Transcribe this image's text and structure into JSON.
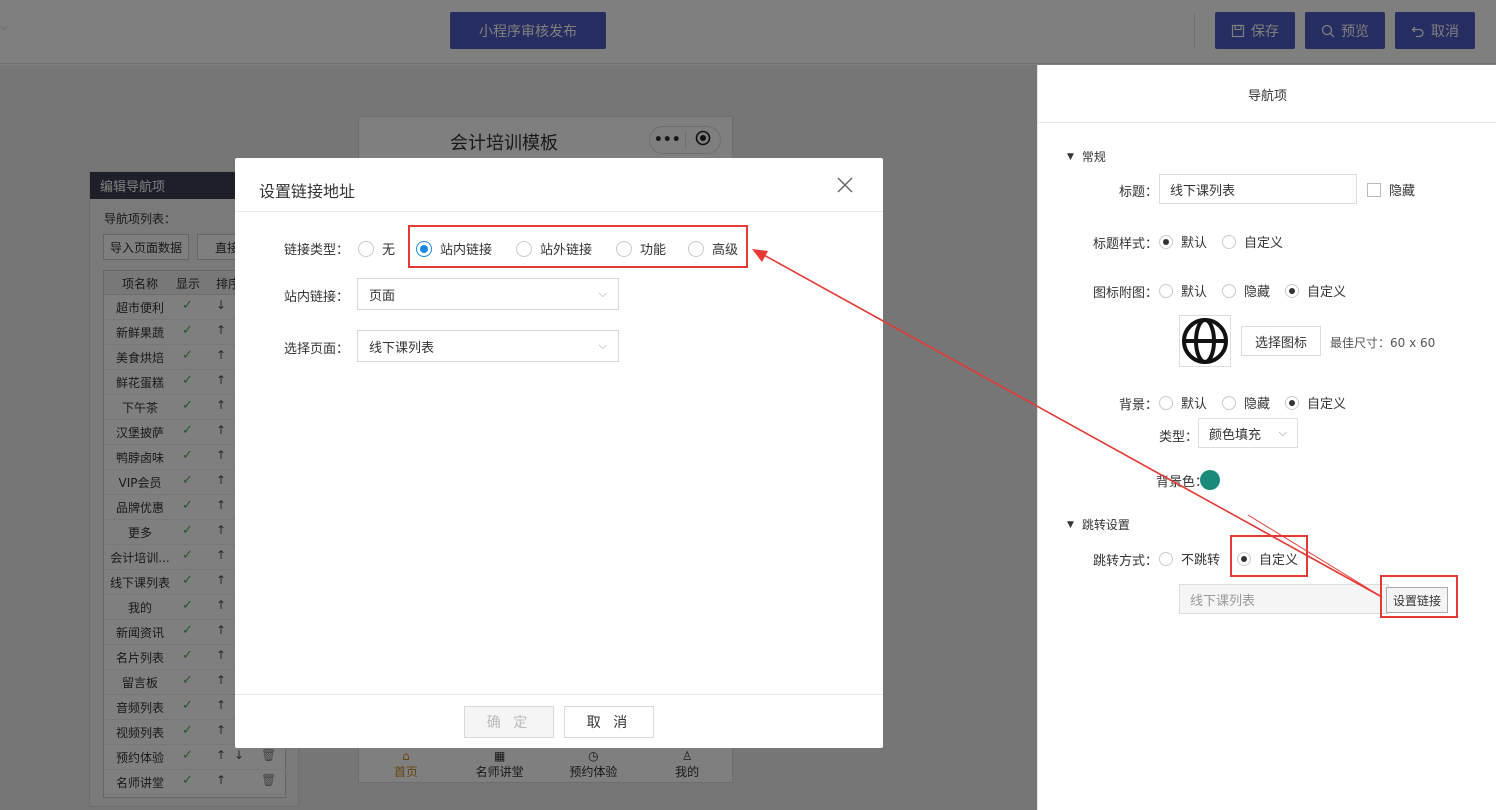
{
  "topbar": {
    "publish_label": "小程序审核发布",
    "save_label": "保存",
    "preview_label": "预览",
    "cancel_label": "取消"
  },
  "nav_panel": {
    "title": "编辑导航项",
    "list_label": "导航项列表：",
    "import_button": "导入页面数据",
    "direct_button": "直接",
    "columns": [
      "项名称",
      "显示",
      "排序"
    ],
    "rows": [
      {
        "name": "超市便利",
        "arrows": "↓"
      },
      {
        "name": "新鲜果蔬",
        "arrows": "↑"
      },
      {
        "name": "美食烘焙",
        "arrows": "↑"
      },
      {
        "name": "鲜花蛋糕",
        "arrows": "↑"
      },
      {
        "name": "下午茶",
        "arrows": "↑"
      },
      {
        "name": "汉堡披萨",
        "arrows": "↑"
      },
      {
        "name": "鸭脖卤味",
        "arrows": "↑"
      },
      {
        "name": "VIP会员",
        "arrows": "↑"
      },
      {
        "name": "品牌优惠",
        "arrows": "↑"
      },
      {
        "name": "更多",
        "arrows": "↑"
      },
      {
        "name": "会计培训...",
        "arrows": "↑"
      },
      {
        "name": "线下课列表",
        "arrows": "↑"
      },
      {
        "name": "我的",
        "arrows": "↑"
      },
      {
        "name": "新闻资讯",
        "arrows": "↑"
      },
      {
        "name": "名片列表",
        "arrows": "↑"
      },
      {
        "name": "留言板",
        "arrows": "↑"
      },
      {
        "name": "音频列表",
        "arrows": "↑"
      },
      {
        "name": "视频列表",
        "arrows": "↑"
      },
      {
        "name": "预约体验",
        "arrows": "↑",
        "arrows2": "↓",
        "trash": true
      },
      {
        "name": "名师讲堂",
        "arrows": "↑",
        "trash": true
      }
    ]
  },
  "phone": {
    "title": "会计培训模板",
    "tabs": [
      "首页",
      "名师讲堂",
      "预约体验",
      "我的"
    ]
  },
  "right_panel": {
    "title": "导航项",
    "section_general": "常规",
    "title_label": "标题：",
    "title_value": "线下课列表",
    "hide_label": "隐藏",
    "title_style_label": "标题样式：",
    "title_style_options": [
      "默认",
      "自定义"
    ],
    "icon_label": "图标附图：",
    "icon_options": [
      "默认",
      "隐藏",
      "自定义"
    ],
    "choose_icon_button": "选择图标",
    "best_size": "最佳尺寸：60 x 60",
    "bg_label": "背景：",
    "bg_options": [
      "默认",
      "隐藏",
      "自定义"
    ],
    "type_label": "类型：",
    "type_value": "颜色填充",
    "bg_color_label": "背景色：",
    "bg_color": "#1a8a7a",
    "section_jump": "跳转设置",
    "jump_mode_label": "跳转方式：",
    "jump_options": [
      "不跳转",
      "自定义"
    ],
    "link_value": "线下课列表",
    "set_link_button": "设置链接"
  },
  "modal": {
    "title": "设置链接地址",
    "link_type_label": "链接类型：",
    "link_types": [
      "无",
      "站内链接",
      "站外链接",
      "功能",
      "高级"
    ],
    "selected_type": "站内链接",
    "inner_link_label": "站内链接：",
    "inner_link_value": "页面",
    "select_page_label": "选择页面：",
    "select_page_value": "线下课列表",
    "confirm_label": "确 定",
    "cancel_label": "取 消"
  },
  "colors": {
    "accent": "#4a5bc2",
    "radio_selected": "#1e88e5",
    "annotation_red": "#e53935"
  }
}
